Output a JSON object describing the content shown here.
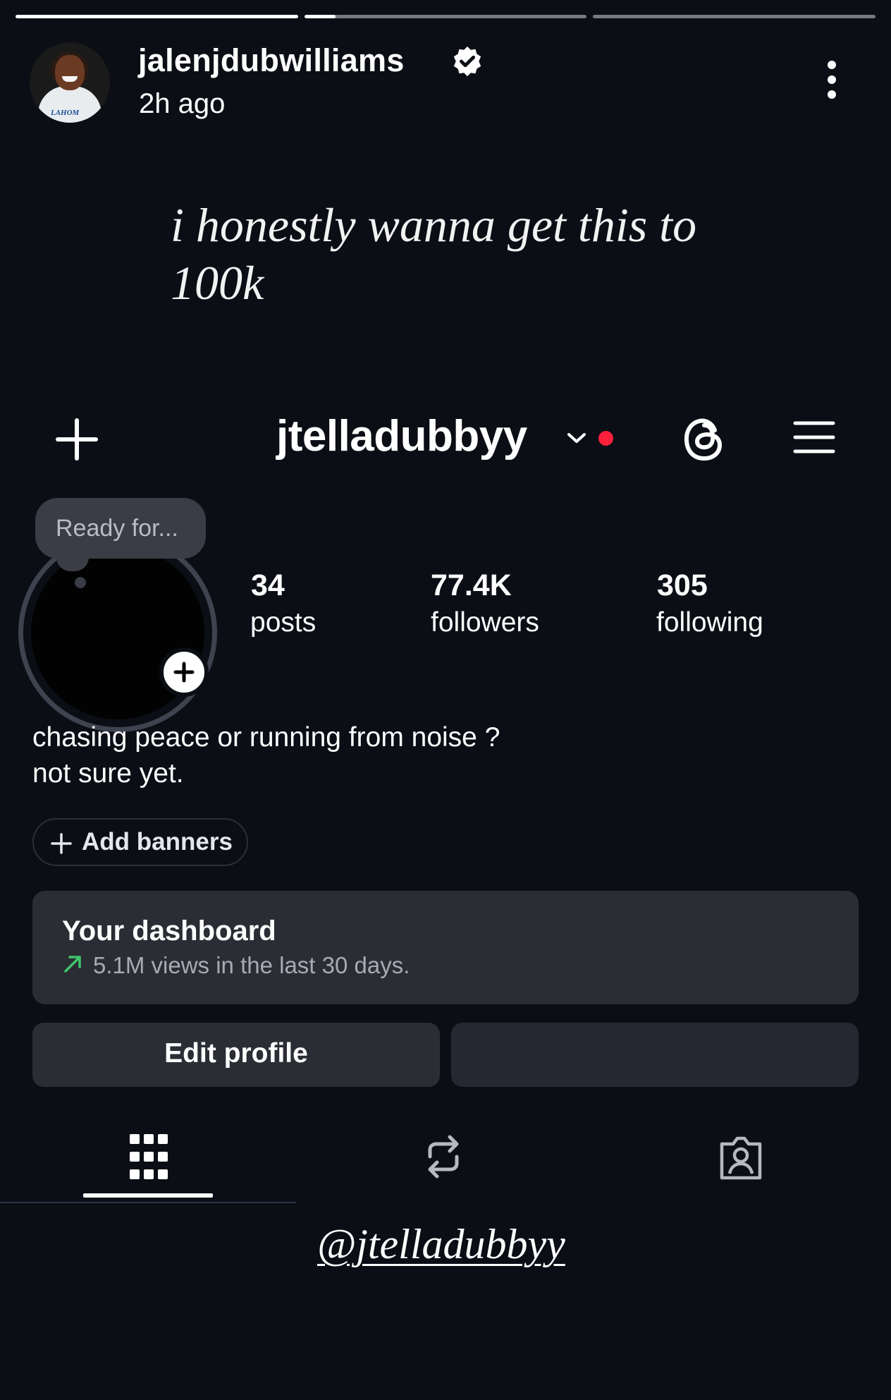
{
  "story": {
    "progress": [
      1.0,
      0.11,
      0.0
    ],
    "username": "jalenjdubwilliams",
    "time_ago": "2h ago",
    "caption": "i honestly wanna get this to 100k",
    "avatar_jersey_text": "LAHOM",
    "mention": "@jtelladubbyy"
  },
  "profile": {
    "handle": "jtelladubbyy",
    "note": "Ready for...",
    "stats": {
      "posts": {
        "value": "34",
        "label": "posts"
      },
      "followers": {
        "value": "77.4K",
        "label": "followers"
      },
      "following": {
        "value": "305",
        "label": "following"
      }
    },
    "bio_line1": "chasing peace or running from noise ?",
    "bio_line2": "not sure yet.",
    "add_banners_label": "Add banners",
    "dashboard": {
      "title": "Your dashboard",
      "subtitle": "5.1M views in the last 30 days."
    },
    "edit_profile_label": "Edit profile",
    "share_profile_label": ""
  },
  "colors": {
    "background": "#0b0e15",
    "card": "#2a2d34",
    "notification_dot": "#ff1f3a",
    "trend_green": "#3fc56b"
  },
  "icons": {
    "verified": "verified-badge-icon",
    "more": "more-vertical-icon",
    "create": "plus-icon",
    "threads": "threads-icon",
    "menu": "hamburger-menu-icon",
    "grid_tab": "grid-icon",
    "reposts_tab": "repost-icon",
    "tagged_tab": "tagged-person-icon"
  }
}
